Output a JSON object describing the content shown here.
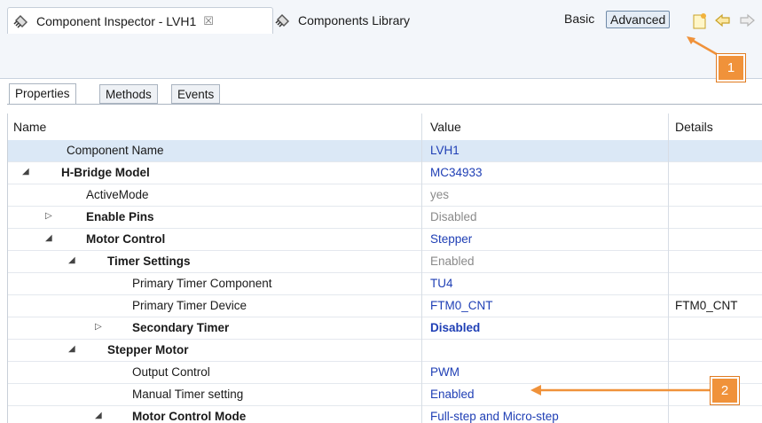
{
  "view_tabs": [
    {
      "label": "Component Inspector - LVH1",
      "close": "☒",
      "active": true
    },
    {
      "label": "Components Library",
      "active": false
    }
  ],
  "mode_buttons": {
    "basic": "Basic",
    "advanced": "Advanced"
  },
  "inner_tabs": [
    "Properties",
    "Methods",
    "Events"
  ],
  "table": {
    "columns": {
      "name": "Name",
      "value": "Value",
      "details": "Details"
    },
    "rows": [
      {
        "name": "Component Name",
        "value": "LVH1",
        "details": "",
        "bold": false,
        "expander": "",
        "value_style": "blue",
        "selected": true
      },
      {
        "name": "H-Bridge Model",
        "value": "MC34933",
        "details": "",
        "bold": true,
        "expander": "◢",
        "value_style": "blue"
      },
      {
        "name": "ActiveMode",
        "value": "yes",
        "details": "",
        "bold": false,
        "expander": "",
        "value_style": "gray"
      },
      {
        "name": "Enable Pins",
        "value": "Disabled",
        "details": "",
        "bold": true,
        "expander": "▷",
        "value_style": "gray"
      },
      {
        "name": "Motor Control",
        "value": "Stepper",
        "details": "",
        "bold": true,
        "expander": "◢",
        "value_style": "blue"
      },
      {
        "name": "Timer Settings",
        "value": "Enabled",
        "details": "",
        "bold": true,
        "expander": "◢",
        "value_style": "gray"
      },
      {
        "name": "Primary Timer Component",
        "value": "TU4",
        "details": "",
        "bold": false,
        "expander": "",
        "value_style": "blue"
      },
      {
        "name": "Primary Timer Device",
        "value": "FTM0_CNT",
        "details": "FTM0_CNT",
        "bold": false,
        "expander": "",
        "value_style": "blue"
      },
      {
        "name": "Secondary Timer",
        "value": "Disabled",
        "details": "",
        "bold": true,
        "expander": "▷",
        "value_style": "blue-bold"
      },
      {
        "name": "Stepper Motor",
        "value": "",
        "details": "",
        "bold": true,
        "expander": "◢",
        "value_style": "blue"
      },
      {
        "name": "Output Control",
        "value": "PWM",
        "details": "",
        "bold": false,
        "expander": "",
        "value_style": "blue"
      },
      {
        "name": "Manual Timer setting",
        "value": "Enabled",
        "details": "",
        "bold": false,
        "expander": "",
        "value_style": "blue"
      },
      {
        "name": "Motor Control Mode",
        "value": "Full-step and Micro-step",
        "details": "",
        "bold": true,
        "expander": "◢",
        "value_style": "blue"
      }
    ]
  },
  "callouts": [
    "1",
    "2"
  ],
  "colors": {
    "accent": "#f0923a",
    "value_blue": "#1f3fb5",
    "selection": "#dbe8f6"
  },
  "icons": [
    "component-icon",
    "library-icon",
    "new-file-icon",
    "back-arrow-icon",
    "forward-arrow-icon"
  ]
}
